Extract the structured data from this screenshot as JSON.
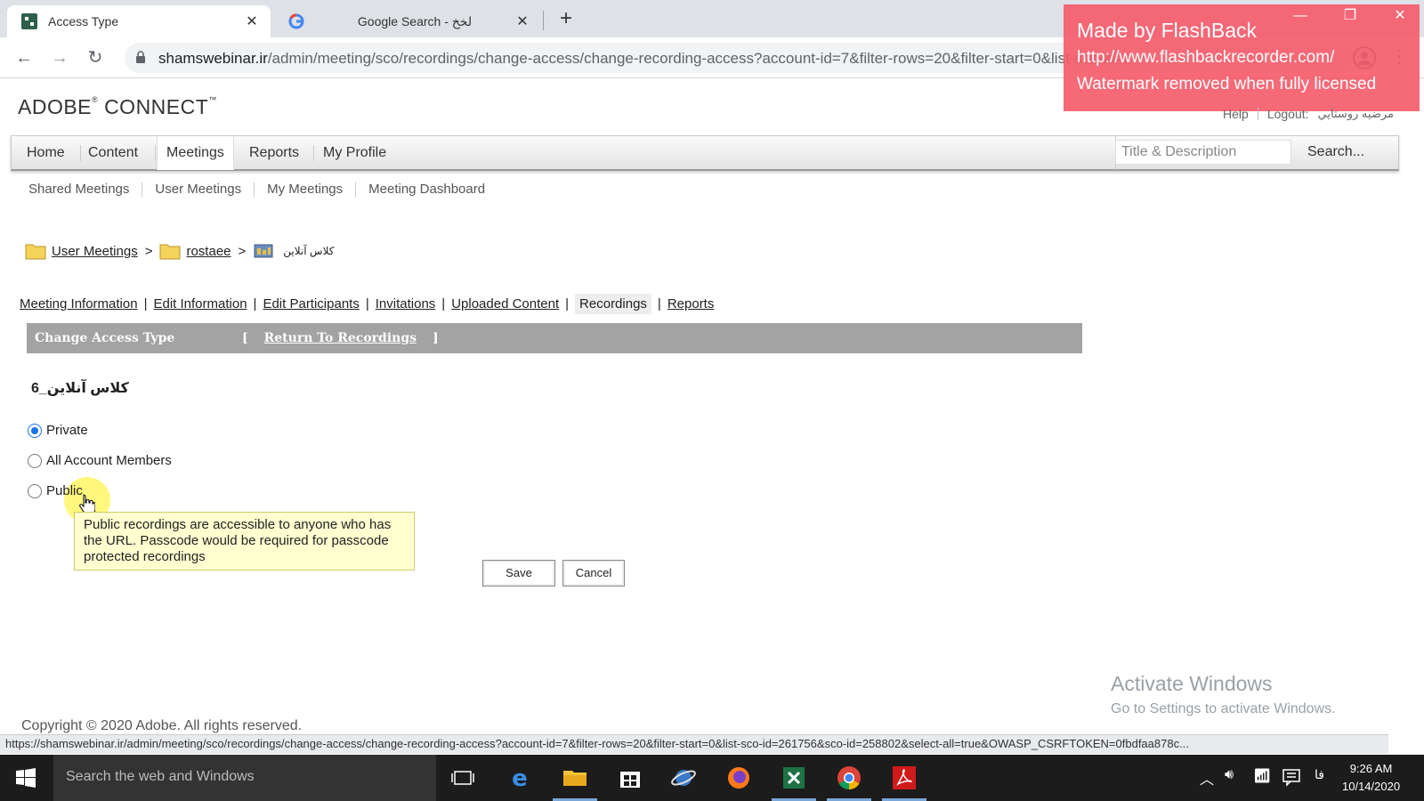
{
  "browser": {
    "tabs": [
      {
        "title": "Access Type",
        "favicon": "adobe-connect-icon"
      },
      {
        "title": "Google Search - لخخ",
        "favicon": "google-icon"
      }
    ],
    "address": {
      "host": "shamswebinar.ir",
      "path": "/admin/meeting/sco/recordings/change-access/change-recording-access?account-id=7&filter-rows=20&filter-start=0&list-sco-id=261756&sco-id=258802&select-all=true"
    },
    "status_url": "https://shamswebinar.ir/admin/meeting/sco/recordings/change-access/change-recording-access?account-id=7&filter-rows=20&filter-start=0&list-sco-id=261756&sco-id=258802&select-all=true&OWASP_CSRFTOKEN=0fbdfaa878c..."
  },
  "watermark": {
    "line1": "Made by FlashBack",
    "line2": "http://www.flashbackrecorder.com/",
    "line3": "Watermark removed when fully licensed"
  },
  "app": {
    "logo": "ADOBE",
    "logo2": "CONNECT",
    "help": "Help",
    "logout": "Logout:",
    "user": "مرضيه روستايي"
  },
  "nav": {
    "items": [
      "Home",
      "Content",
      "Meetings",
      "Reports",
      "My Profile"
    ],
    "selected": "Meetings",
    "search_placeholder": "Title & Description",
    "search_button": "Search..."
  },
  "subnav": [
    "Shared Meetings",
    "User Meetings",
    "My Meetings",
    "Meeting Dashboard"
  ],
  "breadcrumb": [
    "User Meetings",
    "rostaee",
    "کلاس آنلاین"
  ],
  "meeting_tabs": [
    "Meeting Information",
    "Edit Information",
    "Edit Participants",
    "Invitations",
    "Uploaded Content",
    "Recordings",
    "Reports"
  ],
  "meeting_tabs_current": "Recordings",
  "header": {
    "title": "Change Access Type",
    "bracket_open": "[",
    "return_link": "Return To Recordings",
    "bracket_close": "]"
  },
  "recording_name": "کلاس آنلاین_6",
  "options": [
    {
      "label": "Private",
      "checked": true
    },
    {
      "label": "All Account Members",
      "checked": false
    },
    {
      "label": "Public",
      "checked": false
    }
  ],
  "tooltip": "Public recordings are accessible to anyone who has the URL. Passcode would be required for passcode protected recordings",
  "buttons": {
    "save": "Save",
    "cancel": "Cancel"
  },
  "activate": {
    "line1": "Activate Windows",
    "line2": "Go to Settings to activate Windows."
  },
  "copyright": "Copyright © 2020 Adobe. All rights reserved.",
  "taskbar": {
    "search": "Search the web and Windows",
    "lang": "فا",
    "time": "9:26 AM",
    "date": "10/14/2020"
  }
}
